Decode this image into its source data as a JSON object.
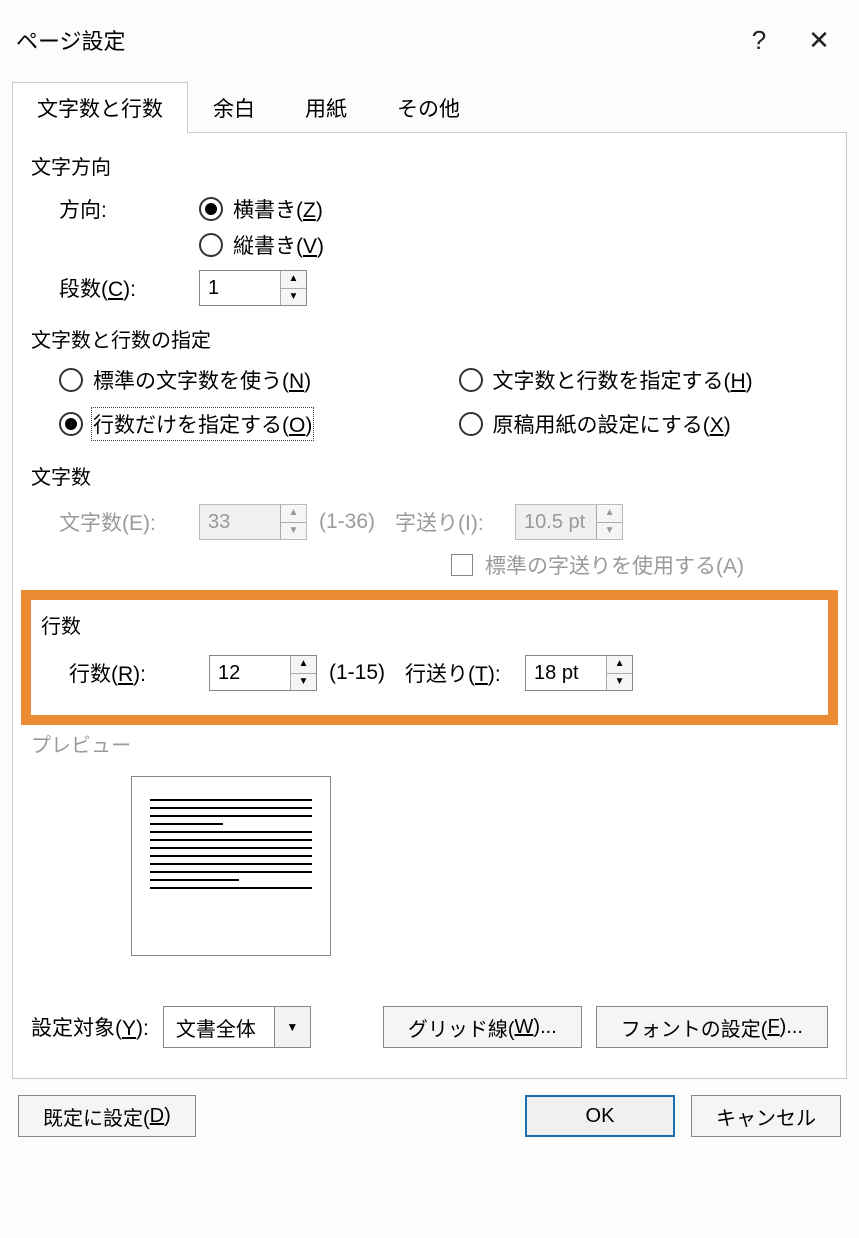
{
  "title": "ページ設定",
  "help_symbol": "?",
  "close_symbol": "✕",
  "tabs": [
    "文字数と行数",
    "余白",
    "用紙",
    "その他"
  ],
  "active_tab_index": 0,
  "sections": {
    "text_direction": {
      "title": "文字方向",
      "direction_label": "方向:",
      "horizontal": {
        "label": "横書き(",
        "key": "Z",
        "suffix": ")"
      },
      "vertical": {
        "label": "縦書き(",
        "key": "V",
        "suffix": ")"
      },
      "columns_label_pre": "段数(",
      "columns_key": "C",
      "columns_label_post": "):",
      "columns_value": "1"
    },
    "spec": {
      "title": "文字数と行数の指定",
      "opt_standard": {
        "label": "標準の文字数を使う(",
        "key": "N",
        "suffix": ")"
      },
      "opt_chars_lines": {
        "label": "文字数と行数を指定する(",
        "key": "H",
        "suffix": ")"
      },
      "opt_lines_only": {
        "label": "行数だけを指定する(",
        "key": "O",
        "suffix": ")"
      },
      "opt_genko": {
        "label": "原稿用紙の設定にする(",
        "key": "X",
        "suffix": ")"
      }
    },
    "chars": {
      "title": "文字数",
      "chars_label": "文字数(E):",
      "chars_value": "33",
      "chars_range": "(1-36)",
      "pitch_label": "字送り(I):",
      "pitch_value": "10.5 pt",
      "std_pitch_label": "標準の字送りを使用する(A)"
    },
    "lines": {
      "title": "行数",
      "lines_label_pre": "行数(",
      "lines_key": "R",
      "lines_label_post": "):",
      "lines_value": "12",
      "lines_range": "(1-15)",
      "line_pitch_label_pre": "行送り(",
      "line_pitch_key": "T",
      "line_pitch_label_post": "):",
      "line_pitch_value": "18 pt"
    },
    "preview": {
      "title": "プレビュー"
    }
  },
  "footer_controls": {
    "apply_to_label_pre": "設定対象(",
    "apply_to_key": "Y",
    "apply_to_label_post": "):",
    "apply_to_value": "文書全体",
    "grid_button_pre": "グリッド線(",
    "grid_button_key": "W",
    "grid_button_post": ")...",
    "font_button_pre": "フォントの設定(",
    "font_button_key": "F",
    "font_button_post": ")..."
  },
  "buttons": {
    "set_default_pre": "既定に設定(",
    "set_default_key": "D",
    "set_default_post": ")",
    "ok": "OK",
    "cancel": "キャンセル"
  }
}
